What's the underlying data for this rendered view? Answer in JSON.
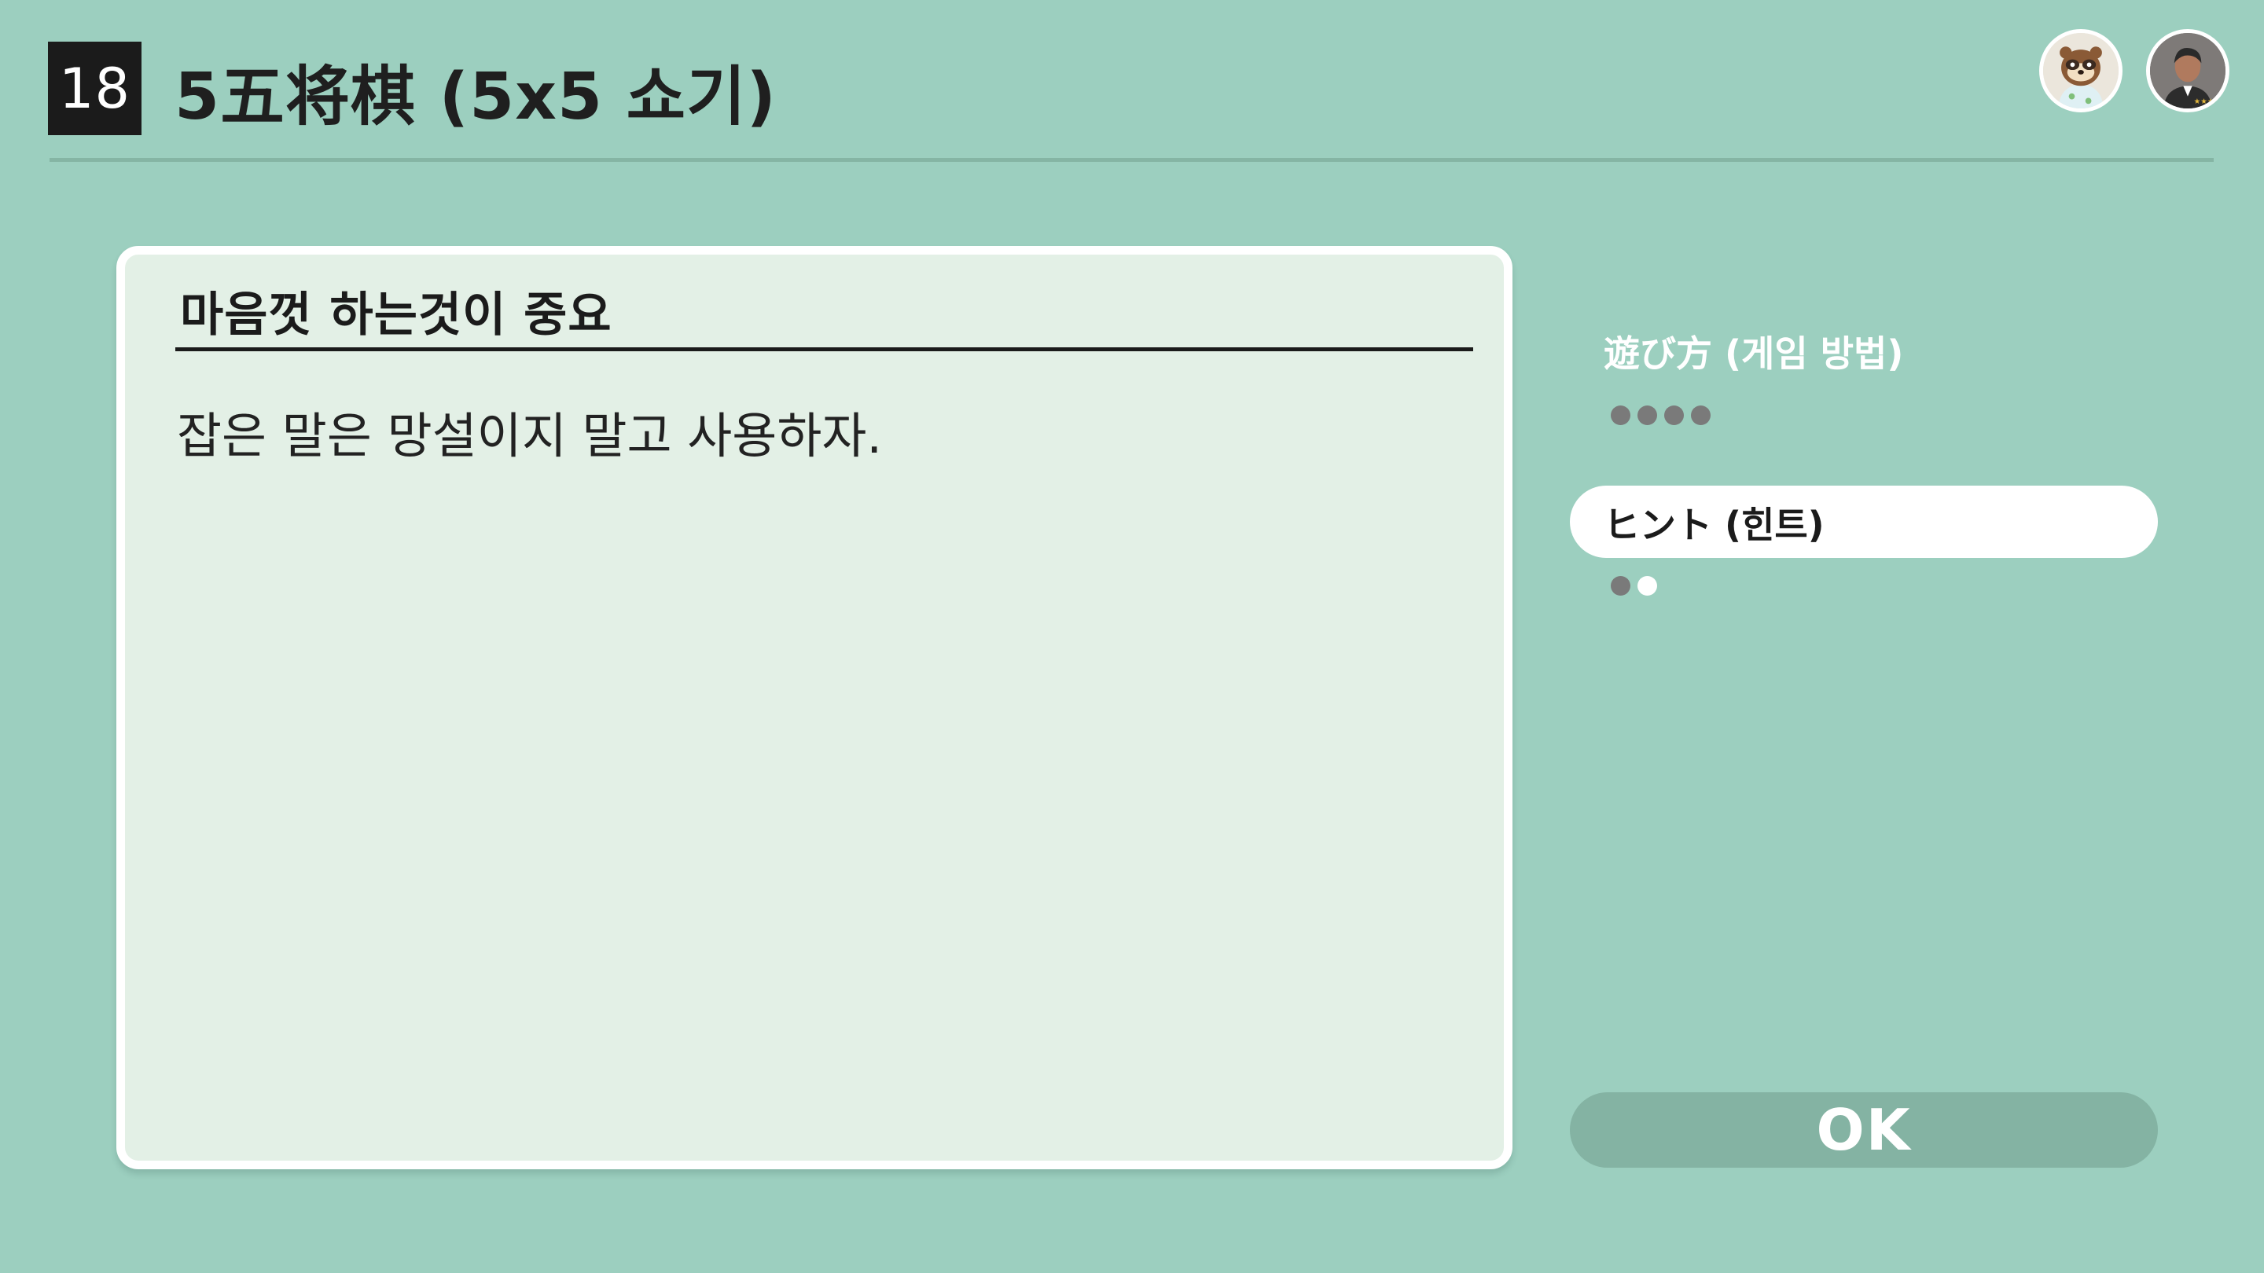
{
  "header": {
    "game_number": "18",
    "title": "5五将棋 (5x5 쇼기)"
  },
  "avatars": [
    {
      "name": "player-1-avatar",
      "icon": "raccoon-character-icon"
    },
    {
      "name": "player-2-avatar",
      "icon": "mii-person-icon"
    }
  ],
  "panel": {
    "heading": "마음껏 하는것이 중요",
    "body": "잡은 말은 망설이지 말고 사용하자."
  },
  "menu": {
    "items": [
      {
        "label": "遊び方 (게임 방법)",
        "selected": false,
        "pages": 4,
        "current_page": 4,
        "dot_states": [
          "read",
          "read",
          "read",
          "read"
        ]
      },
      {
        "label": "ヒント (힌트)",
        "selected": true,
        "pages": 2,
        "current_page": 2,
        "dot_states": [
          "read",
          "current"
        ]
      }
    ]
  },
  "ok_button": {
    "label": "OK"
  },
  "colors": {
    "background": "#9ccfbf",
    "panel": "#e3f0e6",
    "dot_read": "#7a7a7a",
    "dot_current": "#ffffff",
    "ok_button": "#84b3a3"
  }
}
